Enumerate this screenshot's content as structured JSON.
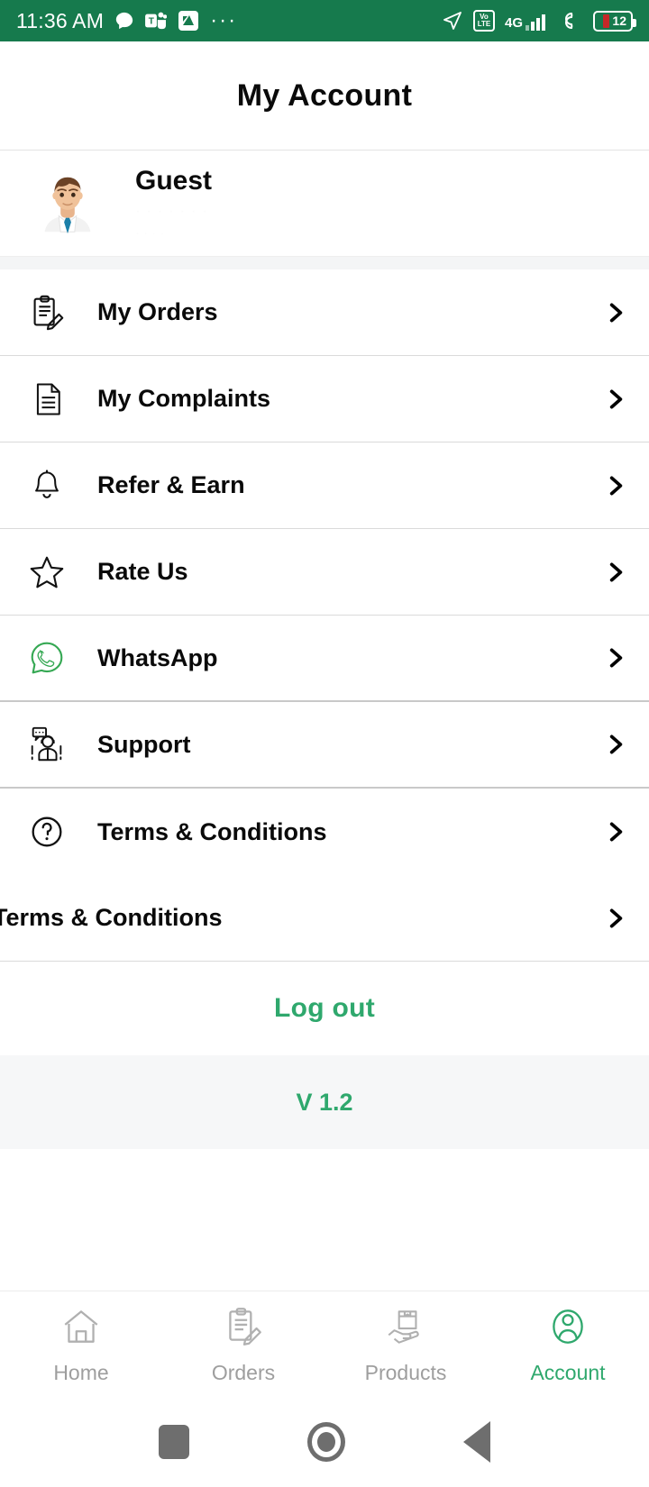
{
  "status_bar": {
    "time": "11:36 AM",
    "left_icons": [
      "chat-bubble-icon",
      "teams-icon",
      "app-icon",
      "more-dots-icon"
    ],
    "right_icons": [
      "location-arrow-icon",
      "volte-icon",
      "signal-4g-icon",
      "sync-icon",
      "battery-icon"
    ],
    "volte_top": "Vo",
    "volte_bottom": "LTE",
    "network": "4G",
    "battery_level": "12",
    "background_color": "#167a4d"
  },
  "app_bar": {
    "title": "My Account"
  },
  "profile": {
    "avatar": "user-avatar-icon",
    "name": "Guest",
    "detail_line1": "· · · · · · ·",
    "detail_line2": "· · · ·"
  },
  "menu": {
    "items": [
      {
        "label": "My Orders",
        "icon": "clipboard-edit-icon",
        "chevron": "chevron-right-icon",
        "has_icon": true
      },
      {
        "label": "My Complaints",
        "icon": "document-icon",
        "chevron": "chevron-right-icon",
        "has_icon": true
      },
      {
        "label": "Refer & Earn",
        "icon": "bell-icon",
        "chevron": "chevron-right-icon",
        "has_icon": true
      },
      {
        "label": "Rate Us",
        "icon": "star-icon",
        "chevron": "chevron-right-icon",
        "has_icon": true
      },
      {
        "label": "WhatsApp",
        "icon": "whatsapp-icon",
        "chevron": "chevron-right-icon",
        "has_icon": true
      },
      {
        "label": "Support",
        "icon": "support-agent-icon",
        "chevron": "chevron-right-icon",
        "has_icon": true
      },
      {
        "label": "Terms & Conditions",
        "icon": "question-circle-icon",
        "chevron": "chevron-right-icon",
        "has_icon": true
      },
      {
        "label": "Terms & Conditions",
        "icon": "",
        "chevron": "chevron-right-icon",
        "has_icon": false
      }
    ]
  },
  "footer": {
    "logout_label": "Log out",
    "version_label": "V 1.2"
  },
  "bottom_nav": {
    "items": [
      {
        "label": "Home",
        "icon": "home-icon",
        "active": false
      },
      {
        "label": "Orders",
        "icon": "clipboard-edit-icon",
        "active": false
      },
      {
        "label": "Products",
        "icon": "hand-package-icon",
        "active": false
      },
      {
        "label": "Account",
        "icon": "person-icon",
        "active": true
      }
    ]
  },
  "android_nav": {
    "items": [
      "recents-square-icon",
      "home-circle-icon",
      "back-triangle-icon"
    ]
  },
  "colors": {
    "brand_green": "#2fa86d",
    "status_green": "#167a4d",
    "text_dark": "#0a0a0a",
    "text_muted": "#9e9e9e"
  }
}
